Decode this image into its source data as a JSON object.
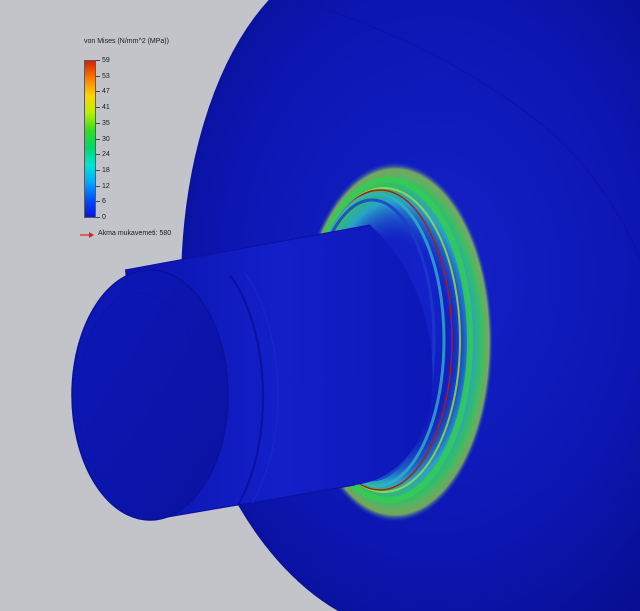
{
  "legend": {
    "title": "von Mises (N/mm^2 (MPa))",
    "ticks": [
      "59",
      "53",
      "47",
      "41",
      "35",
      "30",
      "24",
      "18",
      "12",
      "6",
      "0"
    ],
    "colors": [
      "#d81e05",
      "#ff7b00",
      "#ffd400",
      "#b8f000",
      "#33dd22",
      "#00d86a",
      "#00e6d2",
      "#00a8ff",
      "#0050ff",
      "#0a14d8"
    ],
    "yield_label": "Akma mukavemeti: 580",
    "yield_arrow_color": "#e0201e"
  },
  "model": {
    "base_color": "#0c17b8",
    "stress_colors": [
      "#b41a0a",
      "#21c04a",
      "#2fb3c6",
      "#1a3bd0"
    ]
  }
}
